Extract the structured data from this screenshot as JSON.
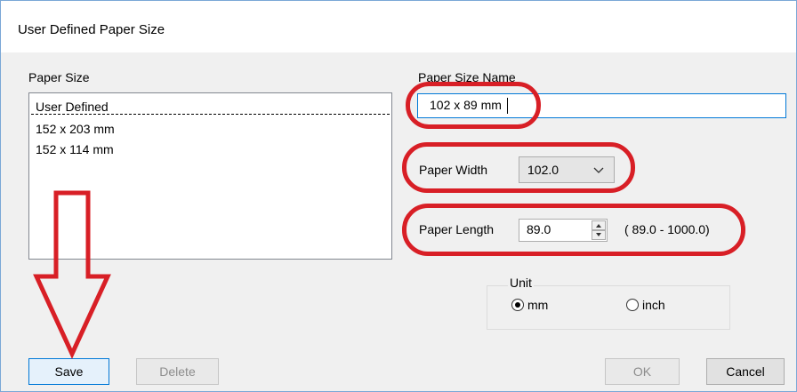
{
  "window": {
    "title": "User Defined Paper Size"
  },
  "paper_size": {
    "label": "Paper Size",
    "items": [
      "User Defined",
      "152 x 203 mm",
      "152 x 114 mm"
    ],
    "selected_index": 0
  },
  "paper_size_name": {
    "label": "Paper Size Name",
    "value": "102 x 89 mm"
  },
  "paper_width": {
    "label": "Paper Width",
    "value": "102.0"
  },
  "paper_length": {
    "label": "Paper Length",
    "value": "89.0",
    "range": "( 89.0 - 1000.0)"
  },
  "unit": {
    "label": "Unit",
    "options": [
      {
        "label": "mm",
        "selected": true
      },
      {
        "label": "inch",
        "selected": false
      }
    ]
  },
  "buttons": {
    "save": "Save",
    "delete": "Delete",
    "ok": "OK",
    "cancel": "Cancel"
  },
  "annotation_color": "#d81f26"
}
